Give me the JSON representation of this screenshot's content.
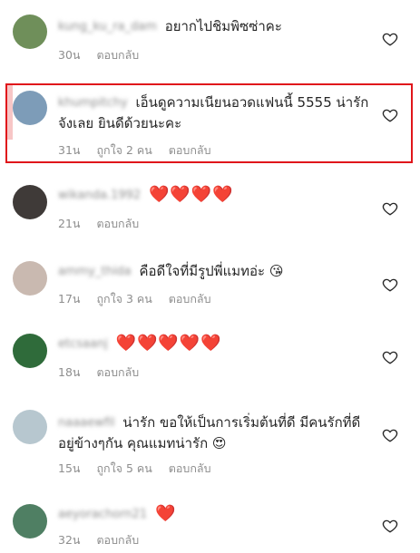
{
  "comments": [
    {
      "username": "kung_ku_ra_dam",
      "text": "อยากไปชิมพิซซ่าคะ",
      "time": "30น",
      "likes": "",
      "reply": "ตอบกลับ",
      "avatar_color": "#6f8f5a"
    },
    {
      "username": "khumpitchy",
      "text": "เอ็นดูความเนียนอวดแฟนนี้ 5555 น่ารักจังเลย ยินดีด้วยนะคะ",
      "time": "31น",
      "likes": "ถูกใจ 2 คน",
      "reply": "ตอบกลับ",
      "avatar_color": "#7d9cb8"
    },
    {
      "username": "wikanda.1992",
      "text": "❤️❤️❤️❤️",
      "time": "21น",
      "likes": "",
      "reply": "ตอบกลับ",
      "avatar_color": "#3f3a38"
    },
    {
      "username": "ammy_thida",
      "text": "คือดีใจที่มีรูปพี่แมทอ่ะ 😘",
      "time": "17น",
      "likes": "ถูกใจ 3 คน",
      "reply": "ตอบกลับ",
      "avatar_color": "#c9b9b0"
    },
    {
      "username": "etcsaanj",
      "text": "❤️❤️❤️❤️❤️",
      "time": "18น",
      "likes": "",
      "reply": "ตอบกลับ",
      "avatar_color": "#2f6b3a"
    },
    {
      "username": "naaaewfil",
      "text": "น่ารัก ขอให้เป็นการเริ่มต้นที่ดี มีคนรักที่ดีอยู่ข้างๆกัน คุณแมทน่ารัก 😍",
      "time": "15น",
      "likes": "ถูกใจ 5 คน",
      "reply": "ตอบกลับ",
      "avatar_color": "#b7c7cf"
    },
    {
      "username": "aeyorachorn21",
      "text": "❤️",
      "time": "32น",
      "likes": "",
      "reply": "ตอบกลับ",
      "avatar_color": "#4f7f63"
    }
  ],
  "colors": {
    "highlight_border": "#e0161b",
    "muted_text": "#8e8e8e",
    "heart_red": "#e0245e"
  },
  "icons": {
    "like": "heart-outline-icon"
  }
}
